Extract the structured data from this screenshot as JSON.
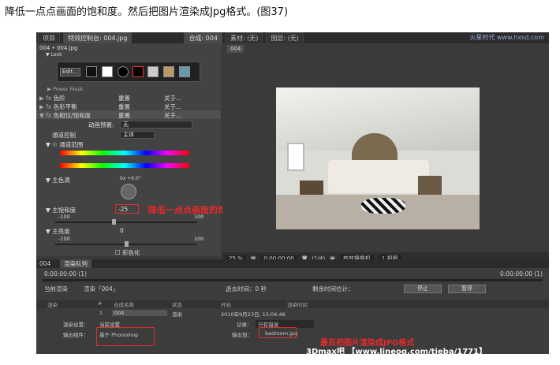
{
  "caption": "降低一点点画面的饱和度。然后把图片渲染成Jpg格式。(图37)",
  "tabs": {
    "project": "项目",
    "effect_controls": "特效控制台: 004.jpg",
    "composition": "合成: 004",
    "footage": "素材: (无)",
    "layer": "图层: (无)"
  },
  "left": {
    "header": "004 • 004.jpg",
    "look": "▼ Look",
    "edit_btn": "Edit...",
    "power_mask": "▶ Power Mask",
    "fx1": "色阶",
    "fx2": "色彩平衡",
    "fx3": "色相位/饱和度",
    "reset": "重置",
    "about": "关于...",
    "preset_label": "动画预置:",
    "preset_value": "无",
    "channel_label": "通道控制",
    "channel_value": "主体",
    "channel_range": "▼ ☉ 通道范围",
    "hue_label": "▼ 主色调",
    "hue_value": "0x +0.0°",
    "sat_label": "▼ 主饱和度",
    "sat_value": "-25",
    "sat_min": "-100",
    "sat_max": "100",
    "light_label": "▼ 主亮度",
    "light_value": "0",
    "light_min": "-100",
    "light_max": "100",
    "colorize": "彩色化"
  },
  "right": {
    "comp_tab": "004",
    "zoom": "25 %",
    "time": "0:00:00:00",
    "res": "(1/4)",
    "camera": "有效摄像机",
    "view": "1 视图"
  },
  "bottom": {
    "tab1": "004",
    "tab2": "渲染队列",
    "time_left": "0:00:00:00 (1)",
    "time_right": "0:00:00:00 (1)",
    "current": "当前渲染",
    "rendering": "渲染「004」",
    "elapsed": "逝去时间：0 秒",
    "remaining": "剩余时间估计：",
    "stop": "停止",
    "pause": "暂停",
    "cols": [
      "渲染",
      "#",
      "合成名称",
      "状态",
      "开始",
      "渲染时间"
    ],
    "item_num": "1",
    "item_name": "004",
    "item_status": "渲染",
    "item_start": "2010年9月23日, 15:04:46",
    "settings_label": "渲染设置：",
    "settings_value": "当前设置",
    "log_label": "记录：",
    "log_value": "只有错误",
    "output_label": "输出组件：",
    "output_value": "基于 Photoshop",
    "output_to_label": "输出到：",
    "output_to_value": "bedroom.jpg"
  },
  "annotations": {
    "sat": "降低一点点画面的饱和度",
    "jpg": "最后把图片渲染成JPG格式"
  },
  "watermark": "3Dmax吧 【www.lineog.com/tieba/1771】",
  "logo": "火星时代 www.hxsd.com"
}
